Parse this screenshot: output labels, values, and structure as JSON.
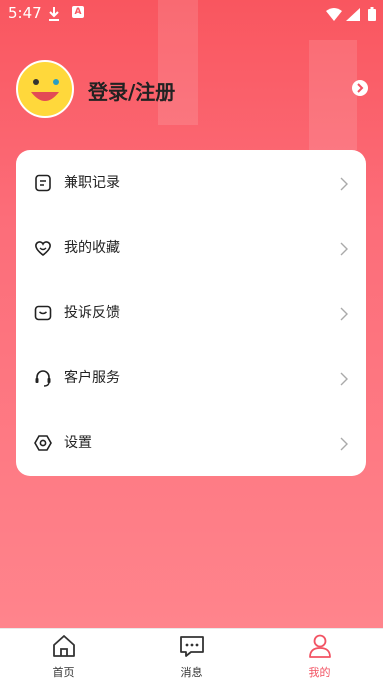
{
  "status_bar": {
    "time": "5:47",
    "a_badge": "A"
  },
  "profile": {
    "login_label": "登录/注册"
  },
  "menu": {
    "items": [
      {
        "label": "兼职记录",
        "icon": "document-icon"
      },
      {
        "label": "我的收藏",
        "icon": "heart-icon"
      },
      {
        "label": "投诉反馈",
        "icon": "feedback-icon"
      },
      {
        "label": "客户服务",
        "icon": "headset-icon"
      },
      {
        "label": "设置",
        "icon": "settings-icon"
      }
    ]
  },
  "tabs": [
    {
      "label": "首页",
      "icon": "home-icon",
      "active": false
    },
    {
      "label": "消息",
      "icon": "message-icon",
      "active": false
    },
    {
      "label": "我的",
      "icon": "profile-icon",
      "active": true
    }
  ],
  "colors": {
    "accent": "#f25363",
    "gradient_top": "#f9565f",
    "gradient_bottom": "#ff848c"
  }
}
